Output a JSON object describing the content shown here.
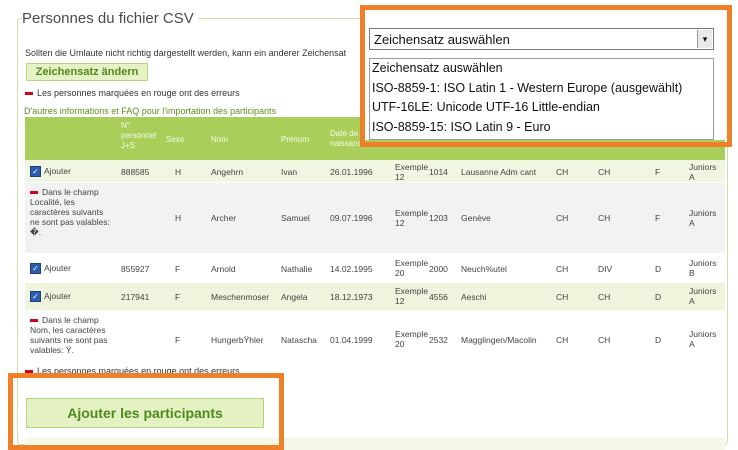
{
  "section": {
    "title": "Personnes du fichier CSV",
    "encoding_hint": "Sollten die Umlaute nicht richtig dargestellt werden, kann ein anderer Zeichensat",
    "change_encoding_button": "Zeichensatz ändern",
    "error_note": "Les personnes marquées en rouge ont des erreurs",
    "faq_link": "D'autres informations et FAQ pour l'importation des participants"
  },
  "table": {
    "headers": {
      "personnel": "N° personnel J+S",
      "sexe": "Sexe",
      "nom": "Nom",
      "prenom": "Prénom",
      "date": "Date de naissance"
    },
    "rows": [
      {
        "action": "Ajouter",
        "error": "",
        "num": "888585",
        "sexe": "H",
        "nom": "Angehrn",
        "prenom": "Ivan",
        "date": "26.01.1996",
        "ex": "Exemple 12",
        "npa": "1014",
        "lieu": "Lausanne Adm cant",
        "c1": "CH",
        "c2": "CH",
        "lang": "F",
        "cat": "Juniors A"
      },
      {
        "action": "",
        "error": "Dans le champ Localité, les caractères suivants ne sont pas valables: �.",
        "num": "",
        "sexe": "H",
        "nom": "Archer",
        "prenom": "Samuel",
        "date": "09.07.1996",
        "ex": "Exemple 12",
        "npa": "1203",
        "lieu": "Genève",
        "c1": "CH",
        "c2": "CH",
        "lang": "F",
        "cat": "Juniors A"
      },
      {
        "action": "Ajouter",
        "error": "",
        "num": "855927",
        "sexe": "F",
        "nom": "Arnold",
        "prenom": "Nathalie",
        "date": "14.02.1995",
        "ex": "Exemple 20",
        "npa": "2000",
        "lieu": "Neuch%utel",
        "c1": "CH",
        "c2": "DIV",
        "lang": "D",
        "cat": "Juniors B"
      },
      {
        "action": "Ajouter",
        "error": "",
        "num": "217941",
        "sexe": "F",
        "nom": "Meschenmoser",
        "prenom": "Angela",
        "date": "18.12.1973",
        "ex": "Exemple 12",
        "npa": "4556",
        "lieu": "Aeschi",
        "c1": "CH",
        "c2": "CH",
        "lang": "D",
        "cat": "Juniors A"
      },
      {
        "action": "",
        "error": "Dans le champ Nom, les caractères suivants ne sont pas valables: Ÿ.",
        "num": "",
        "sexe": "F",
        "nom": "HungerbŸhler",
        "prenom": "Natascha",
        "date": "01.04.1999",
        "ex": "Exemple 20",
        "npa": "2532",
        "lieu": "Magglingen/Macolin",
        "c1": "CH",
        "c2": "CH",
        "lang": "D",
        "cat": "Juniors A"
      }
    ]
  },
  "add_participants_button": "Ajouter les participants",
  "encoding_select": {
    "current": "Zeichensatz auswählen",
    "arrow": "▾",
    "options": [
      "Zeichensatz auswählen",
      "ISO-8859-1: ISO Latin 1 - Western Europe (ausgewählt)",
      "UTF-16LE: Unicode UTF-16 Little-endian",
      "ISO-8859-15: ISO Latin 9 - Euro"
    ]
  },
  "colors": {
    "highlight": "#ef7f29",
    "header_green": "#a9cf5a",
    "error_red": "#d0021b",
    "link_green": "#5b8f1f"
  }
}
